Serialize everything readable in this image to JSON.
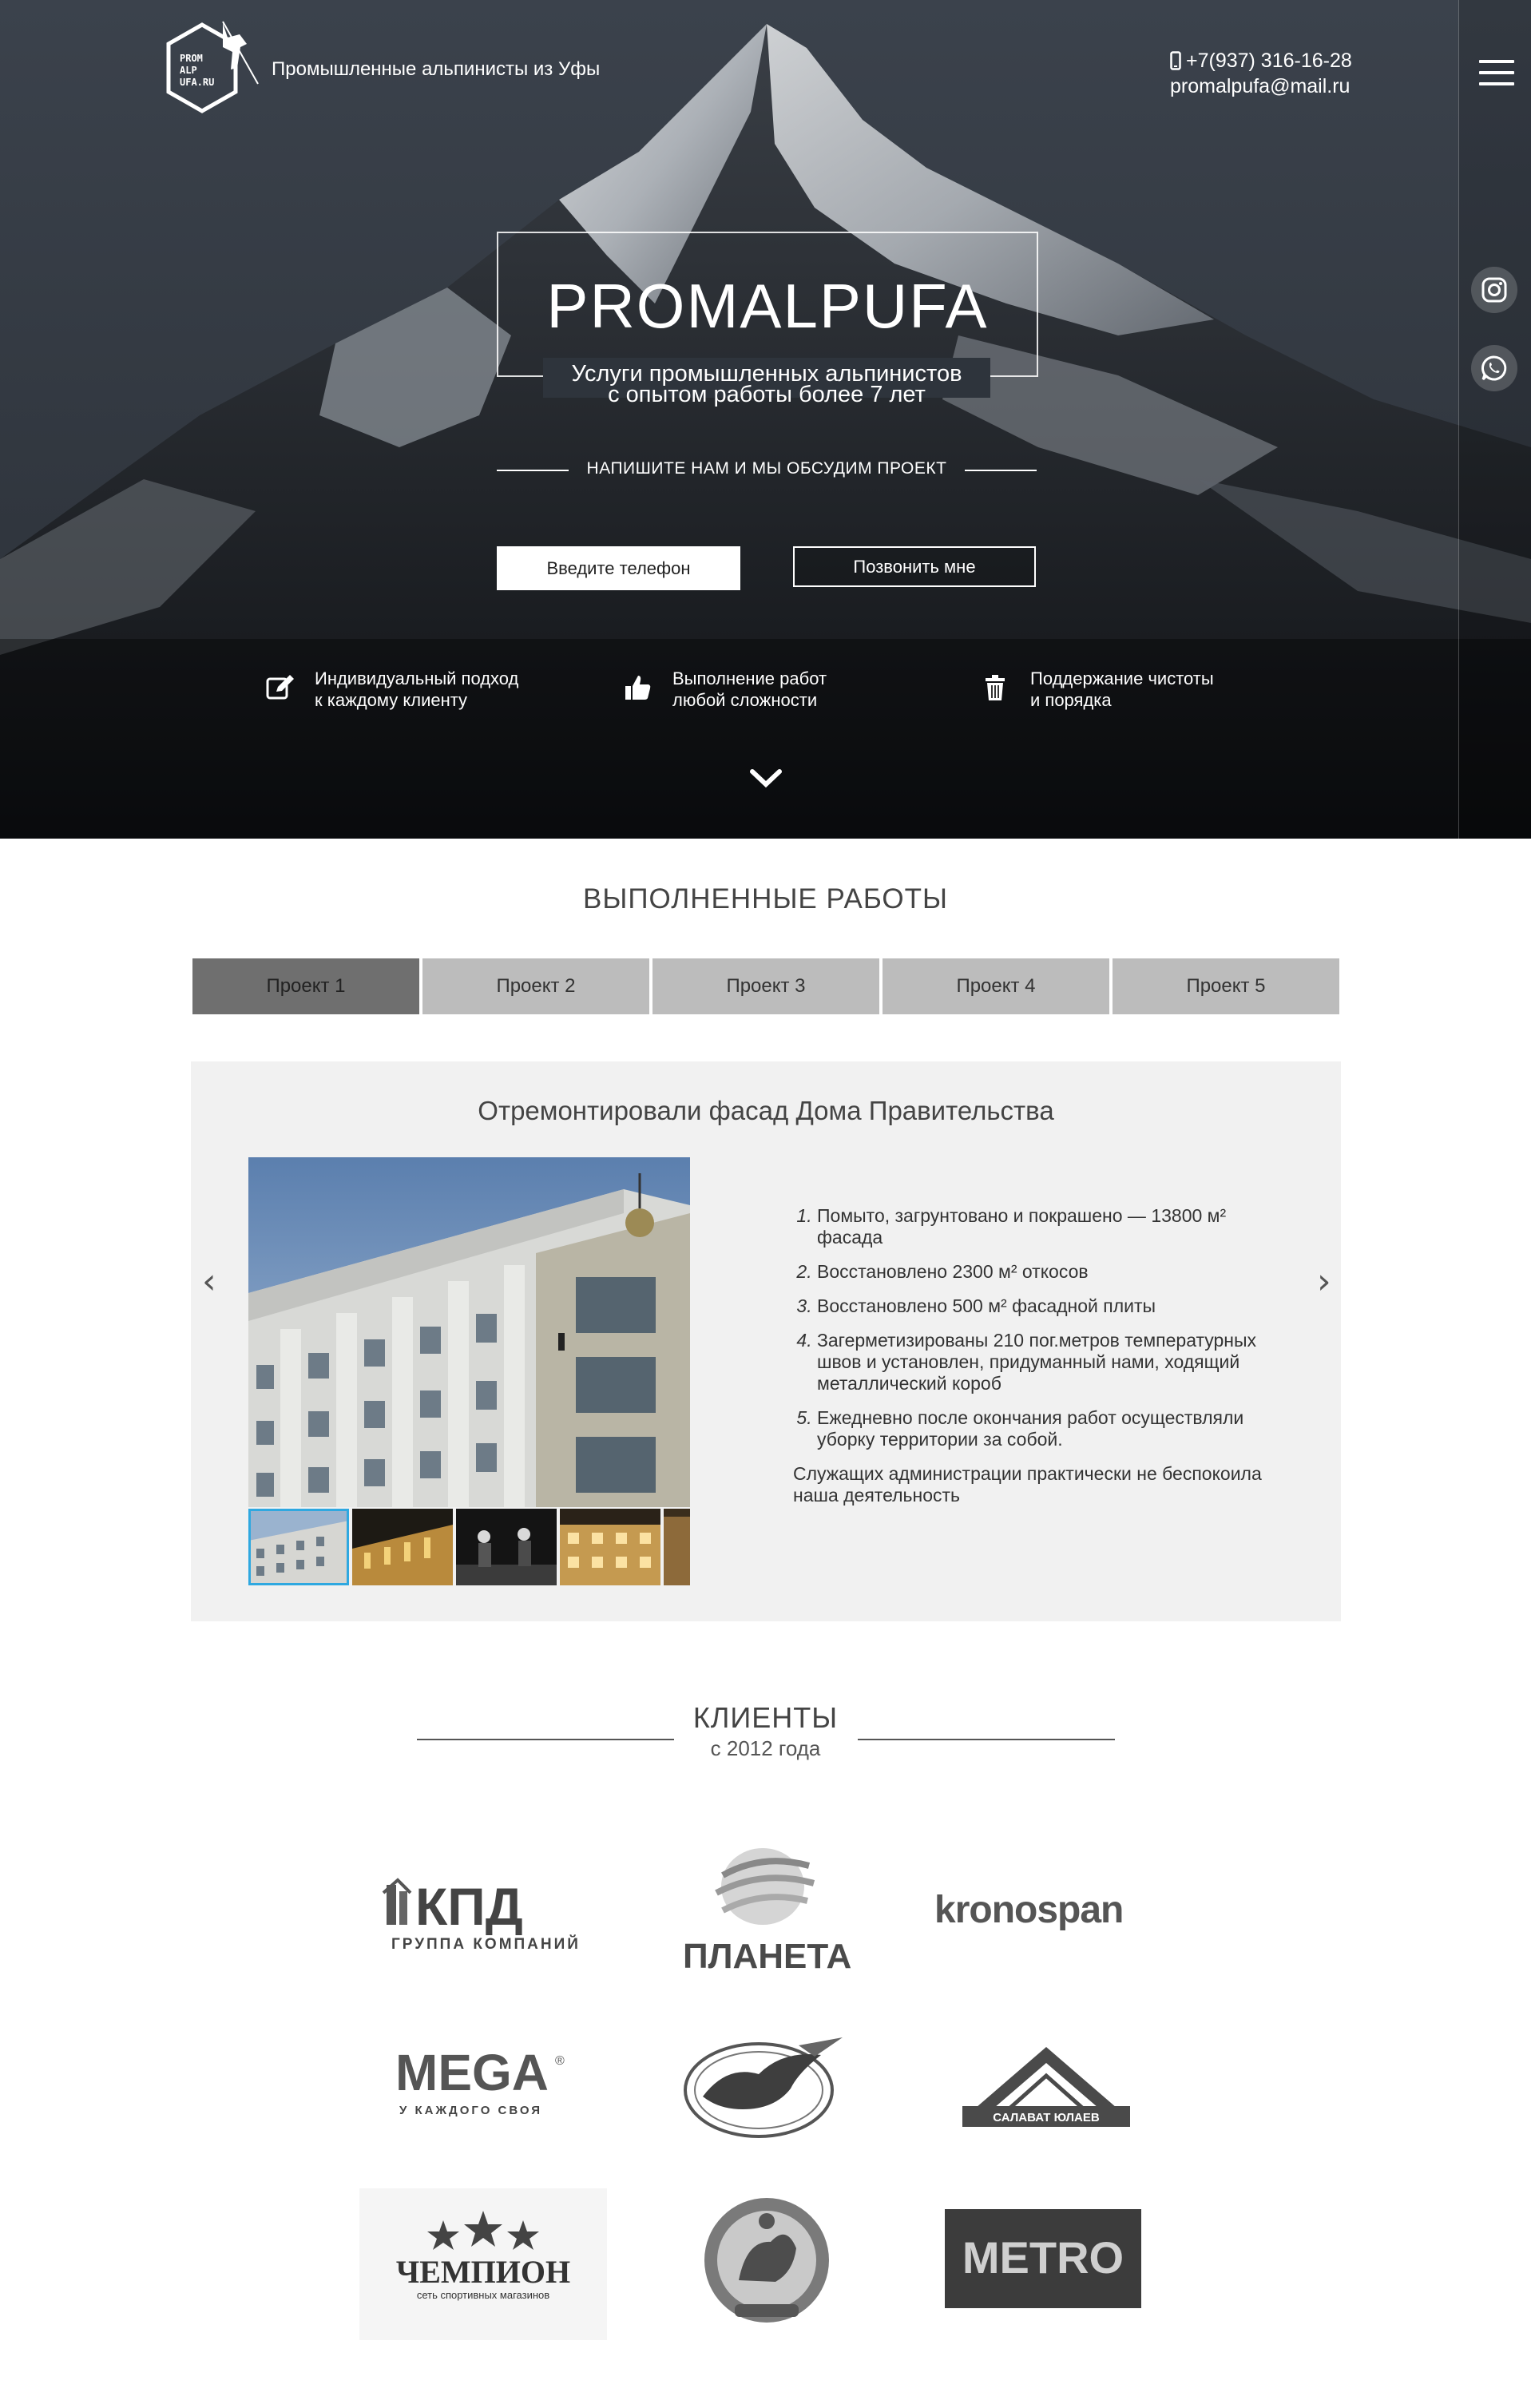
{
  "header": {
    "logo_text": [
      "PROM",
      "ALP",
      "UFA.RU"
    ],
    "tagline": "Промышленные альпинисты из Уфы",
    "phone": "+7(937) 316-16-28",
    "email": "promalpufa@mail.ru"
  },
  "hero": {
    "brand": "PROMALPUFA",
    "subtitle_line1": "Услуги промышленных альпинистов",
    "subtitle_line2": "с опытом работы более 7 лет",
    "cta_text": "НАПИШИТЕ НАМ И МЫ ОБСУДИМ ПРОЕКТ",
    "phone_button": "Введите телефон",
    "call_button": "Позвонить мне",
    "features": [
      {
        "icon": "edit-icon",
        "line1": "Индивидуальный подход",
        "line2": "к каждому клиенту"
      },
      {
        "icon": "thumbs-up-icon",
        "line1": "Выполнение работ",
        "line2": "любой сложности"
      },
      {
        "icon": "trash-icon",
        "line1": "Поддержание чистоты",
        "line2": "и порядка"
      }
    ]
  },
  "sidebar": {
    "icons": [
      "menu-icon",
      "instagram-icon",
      "whatsapp-icon"
    ]
  },
  "works": {
    "title": "ВЫПОЛНЕННЫЕ РАБОТЫ",
    "tabs": [
      "Проект 1",
      "Проект 2",
      "Проект 3",
      "Проект 4",
      "Проект 5"
    ],
    "active_tab": 0,
    "project": {
      "title": "Отремонтировали фасад Дома Правительства",
      "items": [
        "Помыто, загрунтовано и покрашено — 13800 м² фасада",
        "Восстановлено 2300 м² откосов",
        "Восстановлено 500 м² фасадной плиты",
        "Загерметизированы 210 пог.метров температурных швов и установлен, придуманный нами, ходящий металлический короб",
        "Ежедневно после окончания работ осуществляли уборку территории за собой."
      ],
      "note": "Служащих администрации практически не беспокоила наша деятельность",
      "prev": "‹",
      "next": "›"
    }
  },
  "clients": {
    "title": "КЛИЕНТЫ",
    "subtitle": "с 2012 года",
    "logos": [
      {
        "name": "КПД",
        "sub": "ГРУППА КОМПАНИЙ"
      },
      {
        "name": "ПЛАНЕТА",
        "sub": ""
      },
      {
        "name": "kronospan",
        "sub": ""
      },
      {
        "name": "MEGA",
        "sub": "У КАЖДОГО СВОЯ"
      },
      {
        "name": "",
        "sub": ""
      },
      {
        "name": "САЛАВАТ ЮЛАЕВ",
        "sub": ""
      },
      {
        "name": "ЧЕМПИОН",
        "sub": "сеть спортивных магазинов"
      },
      {
        "name": "",
        "sub": ""
      },
      {
        "name": "METRO",
        "sub": ""
      }
    ]
  },
  "colors": {
    "active_tab": "#6f6f6f",
    "inactive_tab": "#bcbcbc",
    "panel_bg": "#f1f1f1",
    "thumb_highlight": "#2fa8e0"
  }
}
